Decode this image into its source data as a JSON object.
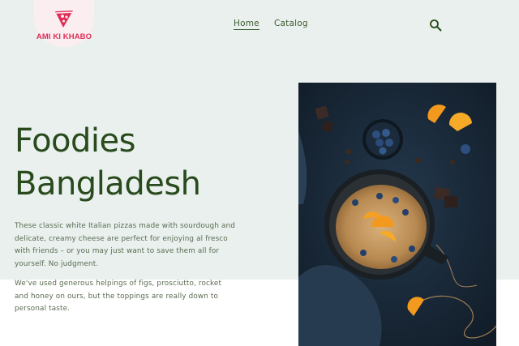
{
  "header": {
    "logo_text": "AMI KI KHABO",
    "nav": [
      {
        "label": "Home",
        "active": true
      },
      {
        "label": "Catalog",
        "active": false
      }
    ],
    "search_icon": "search-icon"
  },
  "hero": {
    "title_line1": "Foodies",
    "title_line2": "Bangladesh",
    "paragraph1": "These classic white Italian pizzas made with sourdough and delicate, creamy cheese are perfect for enjoying al fresco with friends – or you may just want to save them all for yourself. No judgment.",
    "paragraph2": "We've used generous helpings of figs, prosciutto, rocket and honey on ours, but the toppings are really down to personal taste."
  },
  "colors": {
    "accent": "#284a1c",
    "logo": "#e02d56",
    "hero_bg": "#e9f0ed"
  }
}
